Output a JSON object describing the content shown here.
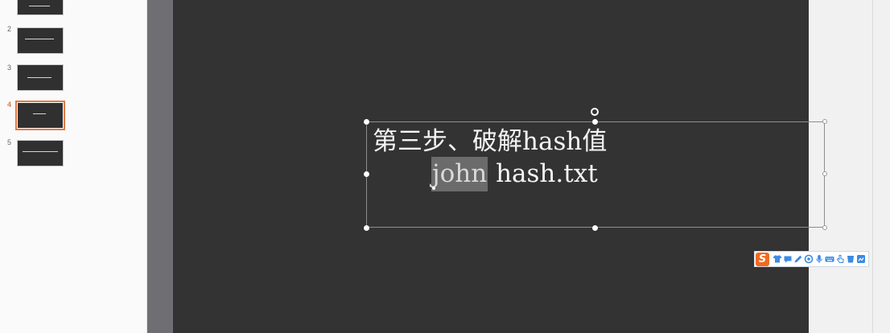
{
  "colors": {
    "accent": "#e07a45",
    "canvas": "#333333",
    "pasteboard": "#6f6f73",
    "panel": "#fafafa",
    "workspace": "#f1f1f1",
    "selection_highlight": "#6b6b6b",
    "ime_logo": "#f06a1e",
    "ime_icon": "#3a8be3"
  },
  "slides_panel": {
    "items": [
      {
        "number": "2",
        "selected": false
      },
      {
        "number": "3",
        "selected": false
      },
      {
        "number": "4",
        "selected": true
      },
      {
        "number": "5",
        "selected": false
      }
    ]
  },
  "slide": {
    "text_box": {
      "line1": "第三步、破解hash值",
      "line2": {
        "selected": "john",
        "rest": " hash.txt"
      }
    }
  },
  "ime_toolbar": {
    "logo": "S",
    "icons": [
      "skin-icon",
      "chat-icon",
      "pen-icon",
      "emoji-icon",
      "mic-icon",
      "keyboard-icon",
      "gesture-icon",
      "cup-icon",
      "toolbox-icon"
    ]
  }
}
